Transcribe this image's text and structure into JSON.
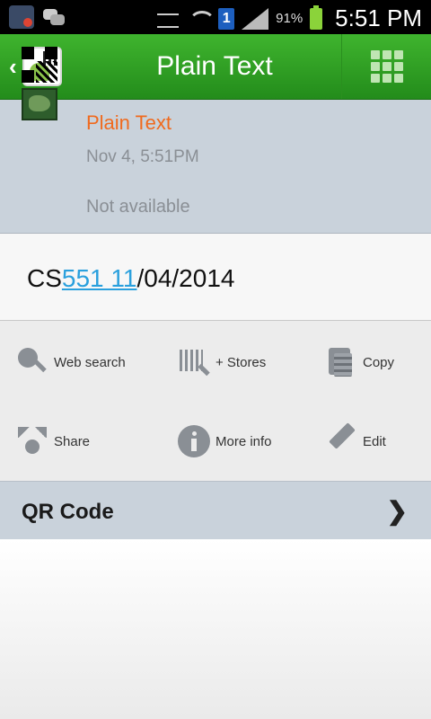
{
  "status_bar": {
    "sim_label": "1",
    "battery_percent": "91%",
    "time": "5:51 PM"
  },
  "action_bar": {
    "title": "Plain Text"
  },
  "header": {
    "type_label": "Plain Text",
    "date": "Nov 4, 5:51PM",
    "location": "Not available"
  },
  "content": {
    "text_prefix": "CS",
    "text_link": "551 11",
    "text_suffix": "/04/2014"
  },
  "actions": [
    {
      "label": "Web search",
      "icon": "web-search-icon"
    },
    {
      "label": "+ Stores",
      "icon": "stores-icon"
    },
    {
      "label": "Copy",
      "icon": "copy-icon"
    },
    {
      "label": "Share",
      "icon": "share-icon"
    },
    {
      "label": "More info",
      "icon": "info-icon"
    },
    {
      "label": "Edit",
      "icon": "edit-icon"
    }
  ],
  "qr_row": {
    "label": "QR Code"
  },
  "colors": {
    "accent_green": "#2ea424",
    "orange": "#f06a1e",
    "link_blue": "#2aa0dd"
  }
}
